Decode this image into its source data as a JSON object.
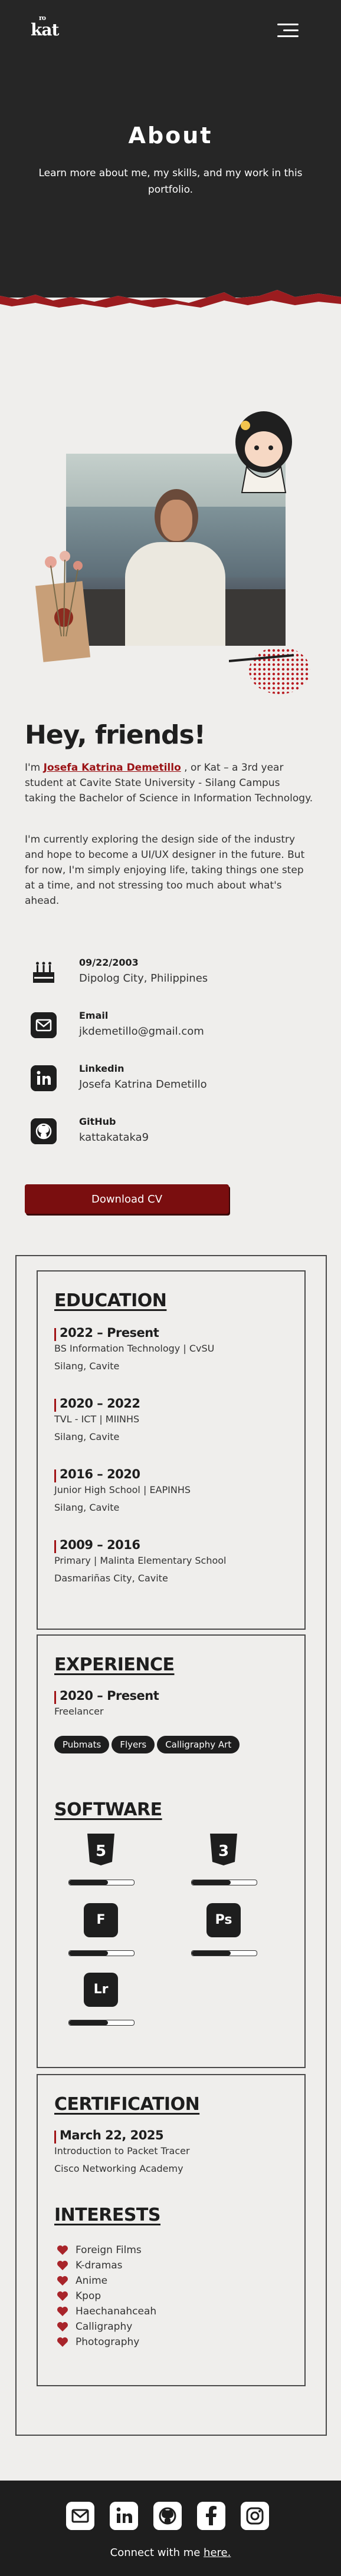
{
  "header": {
    "logo": "kat",
    "logo_small": "ro",
    "title": "About",
    "subtitle": "Learn more about me, my skills, and my work in this portfolio."
  },
  "intro": {
    "heading": "Hey, friends!",
    "p1_prefix": "I'm ",
    "p1_name": "Josefa Katrina Demetillo",
    "p1_suffix": " , or Kat – a 3rd year student at Cavite State University - Silang Campus taking the Bachelor of Science in Information Technology.",
    "p2": "I'm currently exploring the design side of the industry and hope to become a UI/UX designer in the future. But for now, I'm simply enjoying life, taking things one step at a time, and not stressing too much about what's ahead."
  },
  "contact": [
    {
      "label": "09/22/2003",
      "value": "Dipolog City, Philippines",
      "icon": "cake-icon"
    },
    {
      "label": "Email",
      "value": "jkdemetillo@gmail.com",
      "icon": "mail-icon"
    },
    {
      "label": "Linkedin",
      "value": "Josefa Katrina Demetillo",
      "icon": "linkedin-icon"
    },
    {
      "label": "GitHub",
      "value": "kattakataka9",
      "icon": "github-icon"
    }
  ],
  "cv_button": "Download CV",
  "education": {
    "title": "EDUCATION",
    "entries": [
      {
        "years": "2022 – Present",
        "line1": "BS Information Technology | CvSU",
        "line2": "Silang, Cavite"
      },
      {
        "years": "2020 – 2022",
        "line1": "TVL - ICT | MIINHS",
        "line2": "Silang, Cavite"
      },
      {
        "years": "2016 – 2020",
        "line1": "Junior High School | EAPINHS",
        "line2": "Silang, Cavite"
      },
      {
        "years": "2009 – 2016",
        "line1": "Primary | Malinta Elementary School",
        "line2": "Dasmariñas City, Cavite"
      }
    ]
  },
  "experience": {
    "title": "EXPERIENCE",
    "years": "2020 – Present",
    "role": "Freelancer",
    "chips": [
      "Pubmats",
      "Flyers",
      "Calligraphy Art"
    ]
  },
  "software": {
    "title": "SOFTWARE",
    "items": [
      {
        "name": "html5-icon",
        "glyph": "5",
        "level": 0.6
      },
      {
        "name": "css3-icon",
        "glyph": "3",
        "level": 0.6
      },
      {
        "name": "figma-icon",
        "glyph": "F",
        "level": 0.6
      },
      {
        "name": "photoshop-icon",
        "glyph": "Ps",
        "level": 0.6
      },
      {
        "name": "lightroom-icon",
        "glyph": "Lr",
        "level": 0.6
      }
    ]
  },
  "certification": {
    "title": "CERTIFICATION",
    "date": "March 22, 2025",
    "line1": "Introduction to Packet Tracer",
    "line2": "Cisco Networking Academy"
  },
  "interests": {
    "title": "INTERESTS",
    "items": [
      "Foreign Films",
      "K-dramas",
      "Anime",
      "Kpop",
      "Haechanahceah",
      "Calligraphy",
      "Photography"
    ]
  },
  "footer": {
    "text_prefix": "Connect with me ",
    "link": "here."
  },
  "colors": {
    "accent": "#7a0e0f",
    "dark": "#262626",
    "paper": "#efeeec"
  }
}
